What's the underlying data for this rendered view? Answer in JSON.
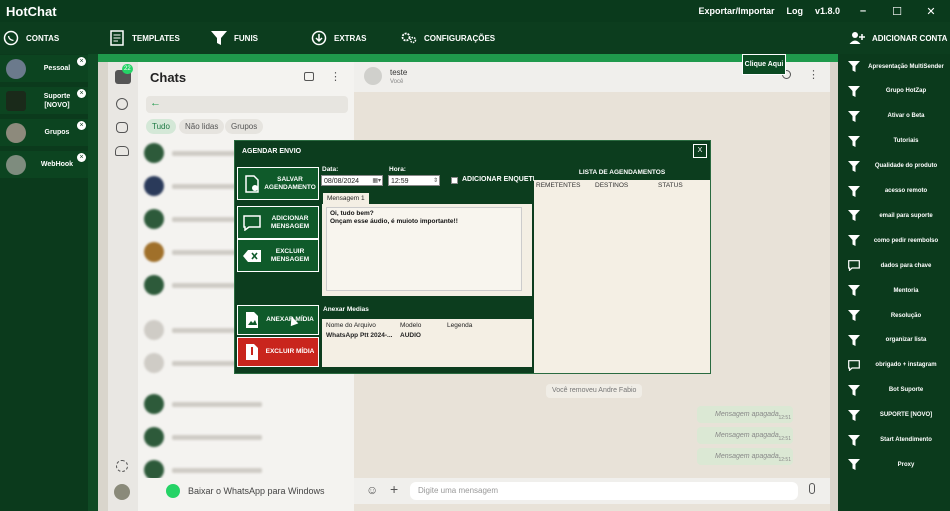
{
  "titlebar": {
    "app_title": "HotChat",
    "export_label": "Exportar/Importar",
    "log_label": "Log",
    "version": "v1.8.0",
    "minimize": "–",
    "maximize": "☐",
    "close": "✕"
  },
  "nav": {
    "contas": "CONTAS",
    "templates": "TEMPLATES",
    "funis": "FUNIS",
    "extras": "EXTRAS",
    "configuracoes": "CONFIGURAÇÕES",
    "adicionar_conta": "ADICIONAR CONTA"
  },
  "accounts": [
    {
      "label": "Pessoal"
    },
    {
      "label": "Suporte\n[NOVO]"
    },
    {
      "label": "Grupos"
    },
    {
      "label": "WebHook"
    }
  ],
  "whatsapp": {
    "badge": "22",
    "chats_title": "Chats",
    "filters": [
      "Tudo",
      "Não lidas",
      "Grupos"
    ],
    "contact_name": "teste",
    "contact_status": "Você",
    "removed_notice": "Você removeu Andre Fabio",
    "deleted_msg": "Mensagem apagada",
    "deleted_time": "12:51",
    "input_placeholder": "Digite uma mensagem",
    "download_label": "Baixar o WhatsApp para Windows"
  },
  "clique_aqui": "Clique Aqui",
  "right_menu": [
    {
      "label": "Apresentação MultiSender",
      "icon": "funnel-icon"
    },
    {
      "label": "Grupo HotZap",
      "icon": "funnel-icon"
    },
    {
      "label": "Ativar o Beta",
      "icon": "funnel-icon"
    },
    {
      "label": "Tutoriais",
      "icon": "funnel-icon"
    },
    {
      "label": "Qualidade do produto",
      "icon": "funnel-icon"
    },
    {
      "label": "acesso remoto",
      "icon": "funnel-icon"
    },
    {
      "label": "email para suporte",
      "icon": "funnel-icon"
    },
    {
      "label": "como pedir reembolso",
      "icon": "funnel-icon"
    },
    {
      "label": "dados para chave",
      "icon": "chat-icon"
    },
    {
      "label": "Mentoria",
      "icon": "funnel-icon"
    },
    {
      "label": "Resolução",
      "icon": "funnel-icon"
    },
    {
      "label": "organizar lista",
      "icon": "funnel-icon"
    },
    {
      "label": "obrigado + instagram",
      "icon": "chat-icon"
    },
    {
      "label": "Bot Suporte",
      "icon": "funnel-icon"
    },
    {
      "label": "SUPORTE [NOVO]",
      "icon": "funnel-icon"
    },
    {
      "label": "Start Atendimento",
      "icon": "funnel-icon"
    },
    {
      "label": "Proxy",
      "icon": "funnel-icon"
    }
  ],
  "dialog": {
    "title": "AGENDAR ENVIO",
    "close": "X",
    "buttons": {
      "salvar": "SALVAR\nAGENDAMENTO",
      "adicionar": "ADICIONAR\nMENSAGEM",
      "excluir": "EXCLUIR\nMENSAGEM",
      "anexar": "ANEXAR MÍDIA",
      "excluir_midia": "EXCLUIR MÍDIA"
    },
    "data_label": "Data:",
    "data_value": "08/08/2024",
    "hora_label": "Hora:",
    "hora_value": "12:59",
    "enquete_label": "ADICIONAR ENQUETE",
    "tab_label": "Mensagem 1",
    "message_text": "Oi, tudo bem?\nOnçam esse áudio, é muioto importante!!",
    "anexar_medias_label": "Anexar Medias",
    "media_headers": [
      "Nome do Arquivo",
      "Modelo",
      "Legenda"
    ],
    "media_rows": [
      {
        "nome": "WhatsApp Ptt 2024-...",
        "modelo": "AUDIO",
        "legenda": ""
      }
    ],
    "schedule_title": "LISTA DE AGENDAMENTOS",
    "schedule_headers": [
      "REMETENTES",
      "DESTINOS",
      "STATUS"
    ]
  }
}
